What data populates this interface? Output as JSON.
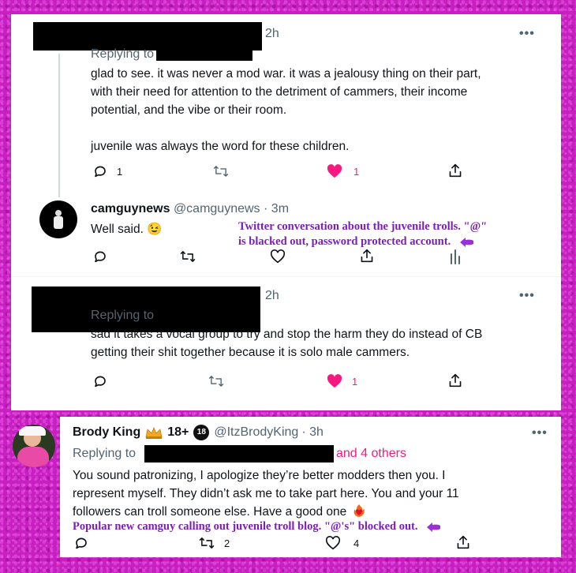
{
  "tweet1": {
    "time": "2h",
    "replying_label": "Replying to",
    "text_line1": "glad to see. it was never a mod war. it was a jealousy thing on their part,",
    "text_line2": "with their need for attention to the detriment of cammers, their income",
    "text_line3": "potential, and the vibe or their room.",
    "text_line4": "juvenile was always the word for these children.",
    "reply_count": "1",
    "like_count": "1",
    "more": "•••"
  },
  "tweet2": {
    "name": "camguynews",
    "handle": "@camguynews",
    "time": "· 3m",
    "text": "Well said.",
    "emoji": "😉"
  },
  "annotation1": {
    "line1": "Twitter conversation about the juvenile trolls.  \"@\"",
    "line2": "is blacked out, password protected account."
  },
  "tweet3": {
    "time": "2h",
    "replying_label": "Replying to",
    "text_line1": "sad it takes a vocal group to try and stop the harm they do instead of CB",
    "text_line2": "getting their shit together because it is solo male cammers.",
    "like_count": "1",
    "more": "•••"
  },
  "tweet4": {
    "name": "Brody King",
    "badge_text": "18+",
    "badge_icon_text": "18",
    "handle": "@ItzBrodyKing",
    "time": "· 3h",
    "replying_label": "Replying to",
    "others": "and 4 others",
    "text_line1": "You sound patronizing, I apologize they’re better modders then you. I",
    "text_line2": "represent myself. They didn’t ask me to take part here. You and your 11",
    "text_line3": "followers can troll someone else. Have a good one",
    "retweet_count": "2",
    "like_count": "4",
    "more": "•••"
  },
  "annotation2": {
    "text": "Popular new camguy calling out juvenile troll blog. \"@'s\" blocked out."
  },
  "colors": {
    "background": "#c81fc0",
    "annotation": "#7a1fb5",
    "like": "#f91880",
    "muted": "#536471"
  }
}
